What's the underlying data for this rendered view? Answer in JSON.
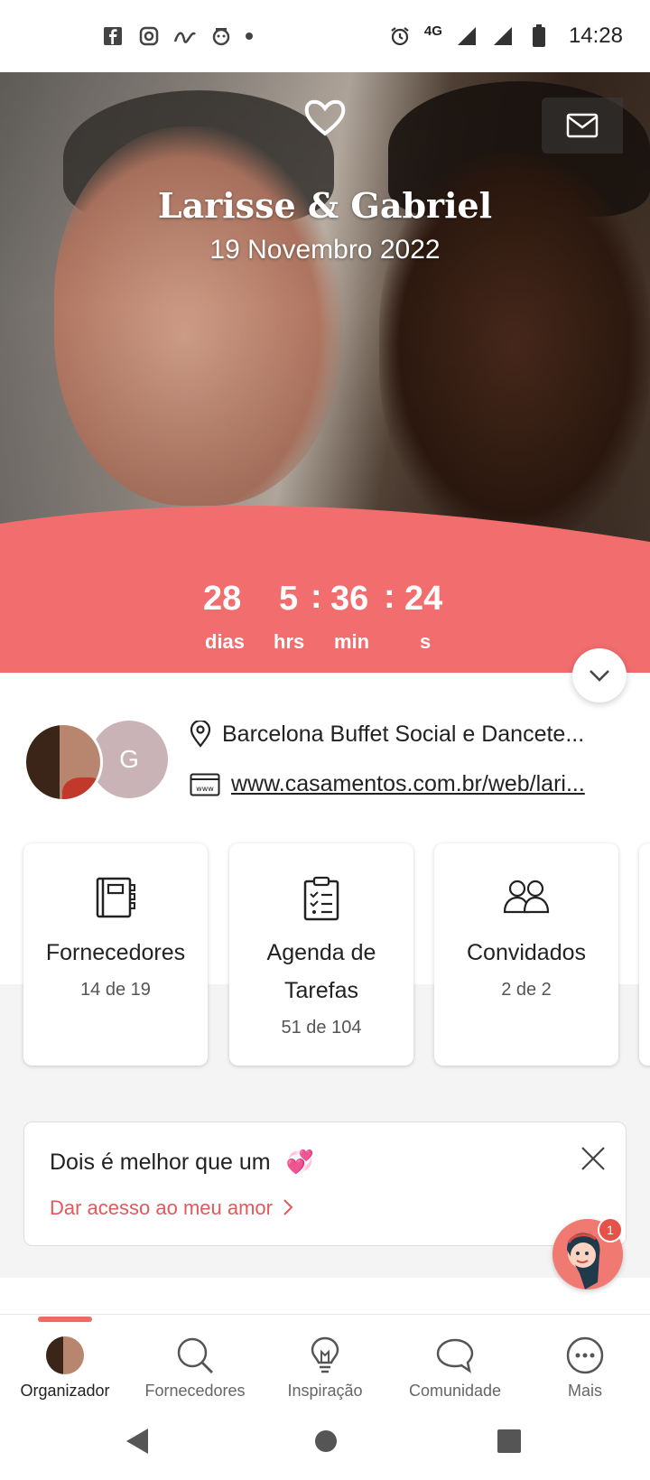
{
  "status_bar": {
    "time": "14:28",
    "network": "4G",
    "left_icons": [
      "facebook-icon",
      "instagram-icon",
      "app-icon",
      "app-icon-2"
    ],
    "right_icons": [
      "alarm-icon",
      "signal-icon",
      "signal-icon-2",
      "battery-icon"
    ]
  },
  "hero": {
    "couple_name": "Larisse & Gabriel",
    "date": "19 Novembro 2022"
  },
  "countdown": {
    "days": "28",
    "hours": "5",
    "minutes": "36",
    "seconds": "24",
    "days_label": "dias",
    "hours_label": "hrs",
    "minutes_label": "min",
    "seconds_label": "s",
    "colors": {
      "bg": "#f26d6d"
    }
  },
  "info": {
    "partner_initial": "G",
    "venue": "Barcelona Buffet Social e Dancete...",
    "website": "www.casamentos.com.br/web/lari..."
  },
  "cards": [
    {
      "title": "Fornecedores",
      "count": "14 de 19",
      "icon": "notebook-icon"
    },
    {
      "title": "Agenda de Tarefas",
      "title_line1": "Agenda de",
      "title_line2": "Tarefas",
      "count": "51 de 104",
      "icon": "checklist-icon"
    },
    {
      "title": "Convidados",
      "count": "2 de 2",
      "icon": "guests-icon"
    }
  ],
  "promo": {
    "title": "Dois é melhor que um",
    "emoji": "💞",
    "link": "Dar acesso ao meu amor"
  },
  "fab": {
    "badge": "1"
  },
  "bottom_nav": [
    {
      "label": "Organizador",
      "icon": "avatar",
      "active": true
    },
    {
      "label": "Fornecedores",
      "icon": "search-icon"
    },
    {
      "label": "Inspiração",
      "icon": "lightbulb-icon"
    },
    {
      "label": "Comunidade",
      "icon": "chat-bubble-icon"
    },
    {
      "label": "Mais",
      "icon": "more-icon"
    }
  ],
  "accent_color": "#f26d6d"
}
